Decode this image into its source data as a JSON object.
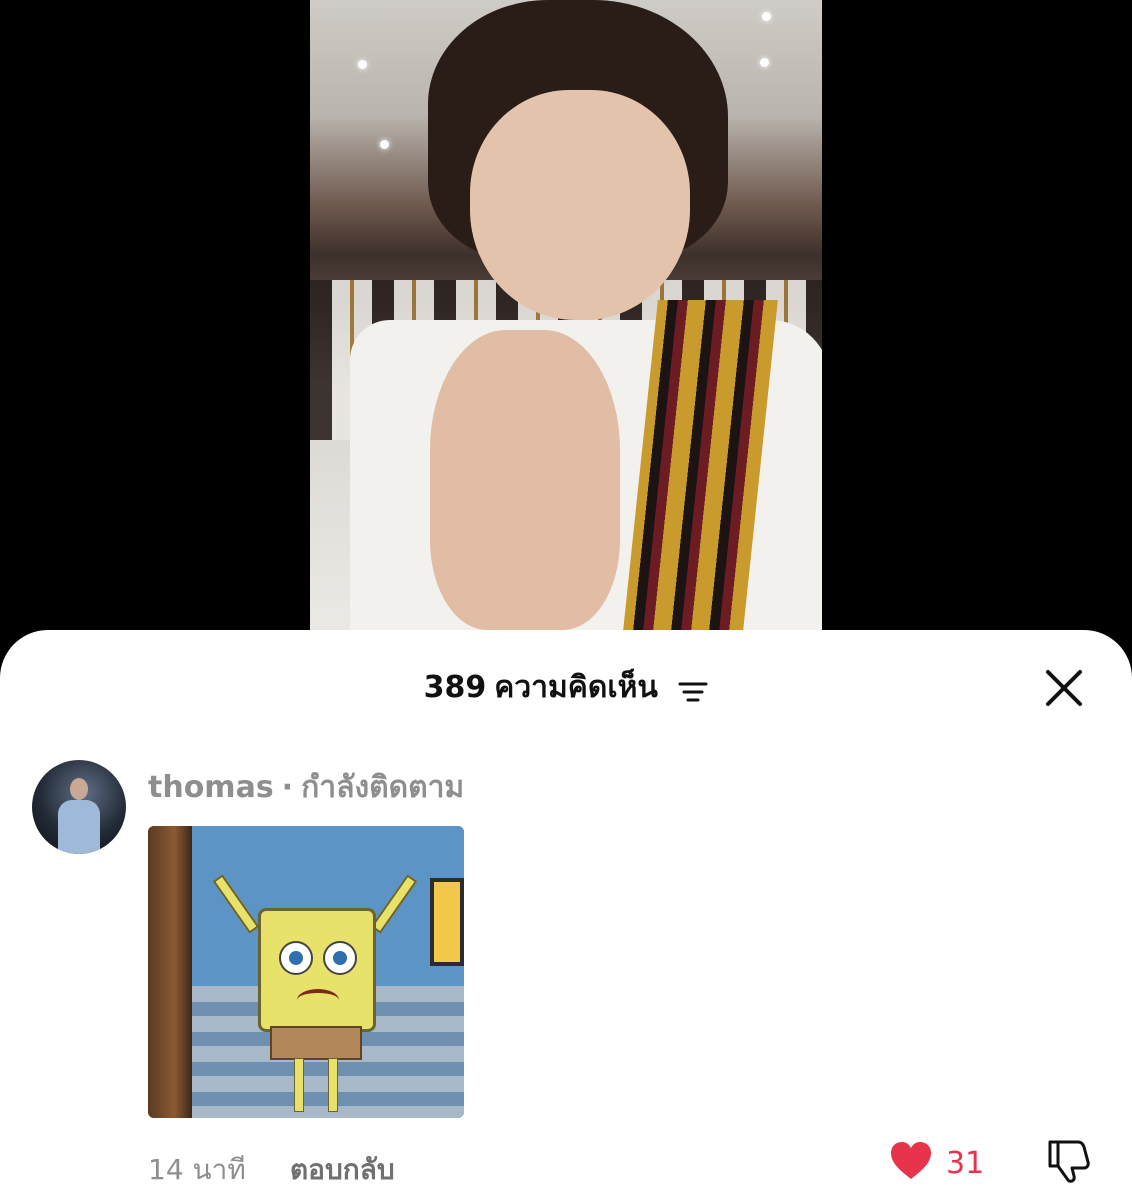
{
  "video": {
    "description_icon": "selfie-video"
  },
  "comments_sheet": {
    "count": "389",
    "title": "ความคิดเห็น",
    "sort_icon": "sort-lines-icon",
    "close_icon": "close-icon"
  },
  "comment": {
    "username": "thomas",
    "separator": "·",
    "status": "กำลังติดตาม",
    "time": "14 นาที",
    "reply_label": "ตอบกลับ",
    "like_count": "31",
    "like_icon": "heart-icon",
    "dislike_icon": "thumbs-down-icon"
  },
  "colors": {
    "like": "#e8334d",
    "meta": "#8e8e8e"
  }
}
